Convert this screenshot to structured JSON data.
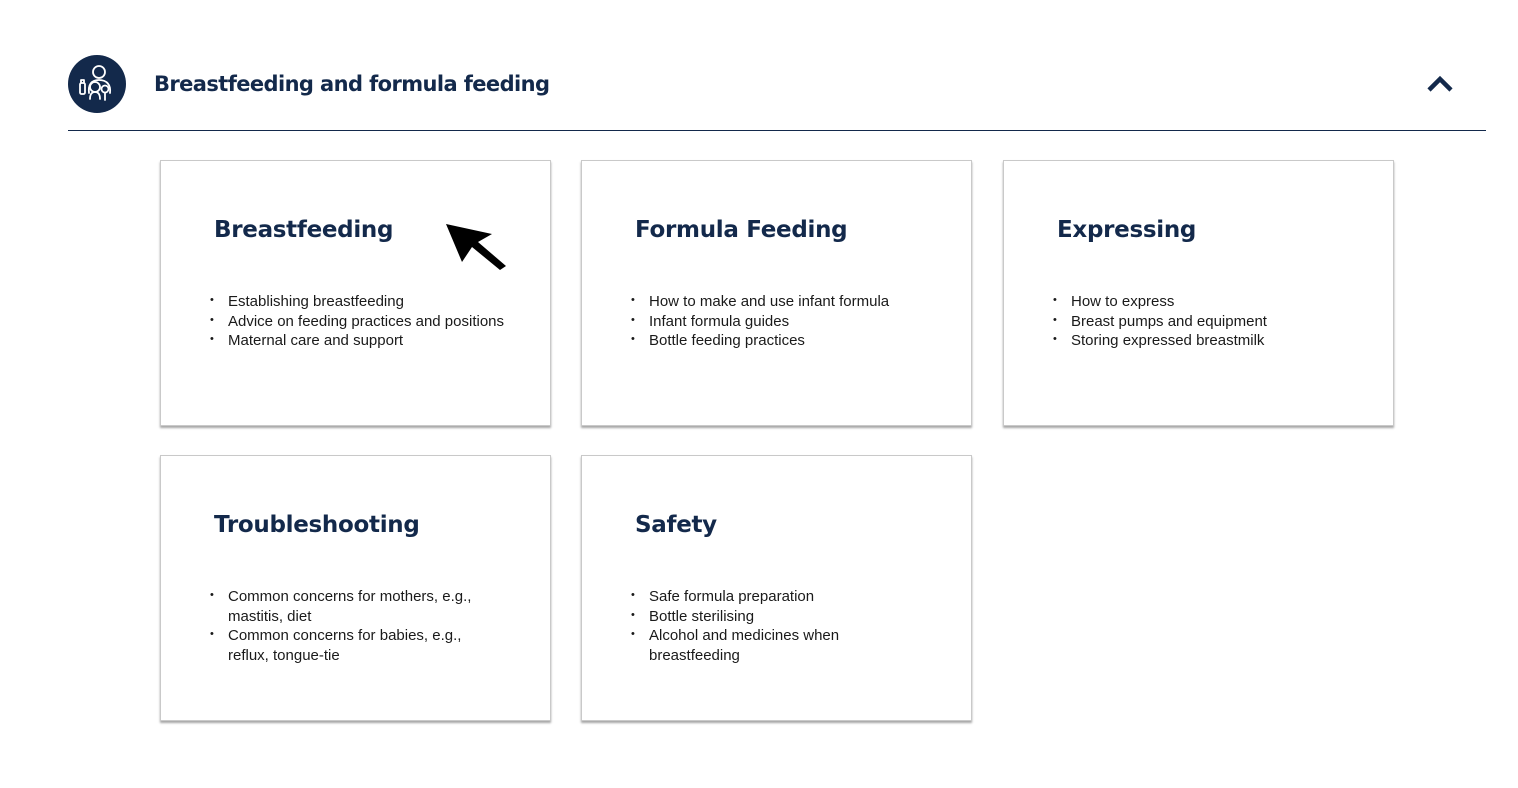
{
  "section": {
    "title": "Breastfeeding and formula feeding",
    "icon": "parent-with-baby-icon",
    "toggle_icon": "chevron-up-icon",
    "accent_color": "#13294b"
  },
  "cards": [
    {
      "title": "Breastfeeding",
      "items": [
        "Establishing breastfeeding",
        "Advice on feeding practices and positions",
        "Maternal care and support"
      ]
    },
    {
      "title": "Formula Feeding",
      "items": [
        "How to make and use infant formula",
        "Infant formula guides",
        "Bottle feeding practices"
      ]
    },
    {
      "title": "Expressing",
      "items": [
        "How to express",
        "Breast pumps and equipment",
        "Storing expressed breastmilk"
      ]
    },
    {
      "title": "Troubleshooting",
      "items": [
        "Common concerns for mothers, e.g., mastitis, diet",
        "Common concerns for babies, e.g., reflux, tongue-tie"
      ]
    },
    {
      "title": "Safety",
      "items": [
        "Safe formula preparation",
        "Bottle sterilising",
        "Alcohol and medicines when breastfeeding"
      ]
    }
  ],
  "cursor": {
    "icon": "mouse-pointer-icon"
  }
}
